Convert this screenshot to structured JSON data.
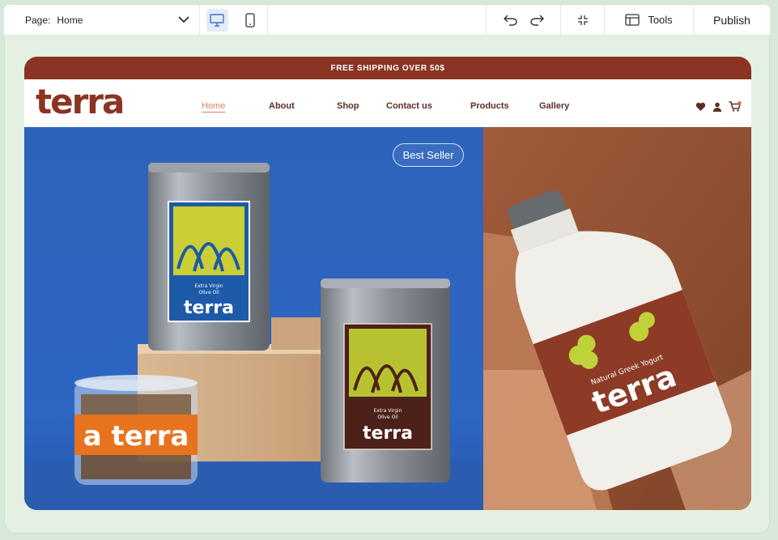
{
  "editor": {
    "page_label": "Page:",
    "page_value": "Home",
    "tools_label": "Tools",
    "publish_label": "Publish"
  },
  "site": {
    "announcement": "FREE SHIPPING OVER 50$",
    "logo": "terra",
    "nav": [
      "Home",
      "About",
      "Shop",
      "Contact us",
      "Products",
      "Gallery"
    ],
    "active_nav": "Home",
    "badge": "Best Seller",
    "product_labels": {
      "oil_tin_1": "Extra Virgin Olive Oil",
      "oil_tin_2": "Extra Virgin Olive Oil",
      "jar": "terra",
      "bottle": "Natural Greek Yogurt"
    }
  },
  "colors": {
    "brand_brown": "#8b3423",
    "nav_text": "#5a2f26",
    "nav_active": "#e0825f",
    "hero_blue": "#2f66bd",
    "hero_brown": "#9d5a3b",
    "editor_bg": "#d9e9d9"
  },
  "icons": [
    "chevron-down-icon",
    "desktop-icon",
    "mobile-icon",
    "undo-icon",
    "redo-icon",
    "fit-icon",
    "tools-icon",
    "heart-icon",
    "user-icon",
    "cart-icon"
  ]
}
